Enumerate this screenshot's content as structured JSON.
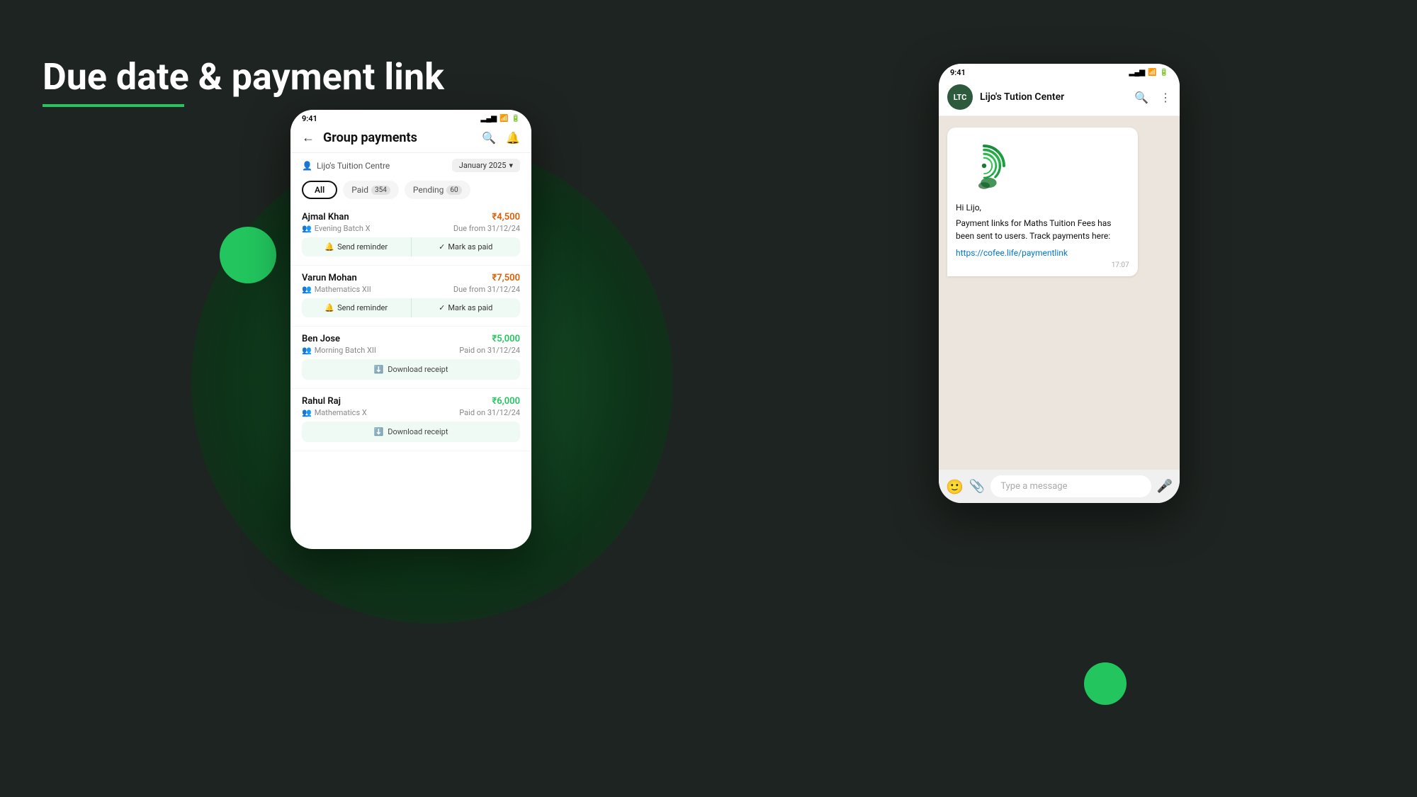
{
  "page": {
    "title": "Due date & payment link",
    "background_color": "#1e2421"
  },
  "phone_left": {
    "status_bar": {
      "time": "9:41",
      "signal": "▂▄▆",
      "wifi": "WiFi",
      "battery": "Battery"
    },
    "header": {
      "title": "Group payments",
      "back_label": "←",
      "search_icon": "search",
      "bell_icon": "bell"
    },
    "tuition": {
      "name": "Lijo's Tuition Centre",
      "month": "January 2025",
      "dropdown_icon": "chevron-down"
    },
    "tabs": {
      "all_label": "All",
      "paid_label": "Paid",
      "paid_count": "354",
      "pending_label": "Pending",
      "pending_count": "60"
    },
    "payments": [
      {
        "name": "Ajmal Khan",
        "amount": "₹4,500",
        "amount_type": "pending",
        "batch": "Evening Batch X",
        "due_label": "Due from 31/12/24",
        "actions": [
          "Send reminder",
          "Mark as paid"
        ]
      },
      {
        "name": "Varun Mohan",
        "amount": "₹7,500",
        "amount_type": "pending",
        "batch": "Mathematics XII",
        "due_label": "Due from 31/12/24",
        "actions": [
          "Send reminder",
          "Mark as paid"
        ]
      },
      {
        "name": "Ben Jose",
        "amount": "₹5,000",
        "amount_type": "paid",
        "batch": "Morning Batch XII",
        "due_label": "Paid on 31/12/24",
        "actions": [
          "Download receipt"
        ]
      },
      {
        "name": "Rahul Raj",
        "amount": "₹6,000",
        "amount_type": "paid",
        "batch": "Mathematics X",
        "due_label": "Paid on 31/12/24",
        "actions": [
          "Download receipt"
        ]
      }
    ]
  },
  "phone_right": {
    "status_bar": {
      "time": "9:41",
      "signal": "▂▄▆",
      "wifi": "WiFi",
      "battery": "Battery"
    },
    "header": {
      "avatar_initials": "LTC",
      "contact_name": "Lijo's Tution Center",
      "search_icon": "search",
      "more_icon": "more-vertical"
    },
    "message": {
      "greeting": "Hi Lijo,",
      "body": "Payment links for Maths Tuition Fees has been sent to users. Track payments here:",
      "link": "https://cofee.life/paymentlink",
      "time": "17:07"
    },
    "input": {
      "placeholder": "Type a message",
      "emoji_icon": "emoji",
      "attach_icon": "paperclip",
      "mic_icon": "mic"
    }
  }
}
